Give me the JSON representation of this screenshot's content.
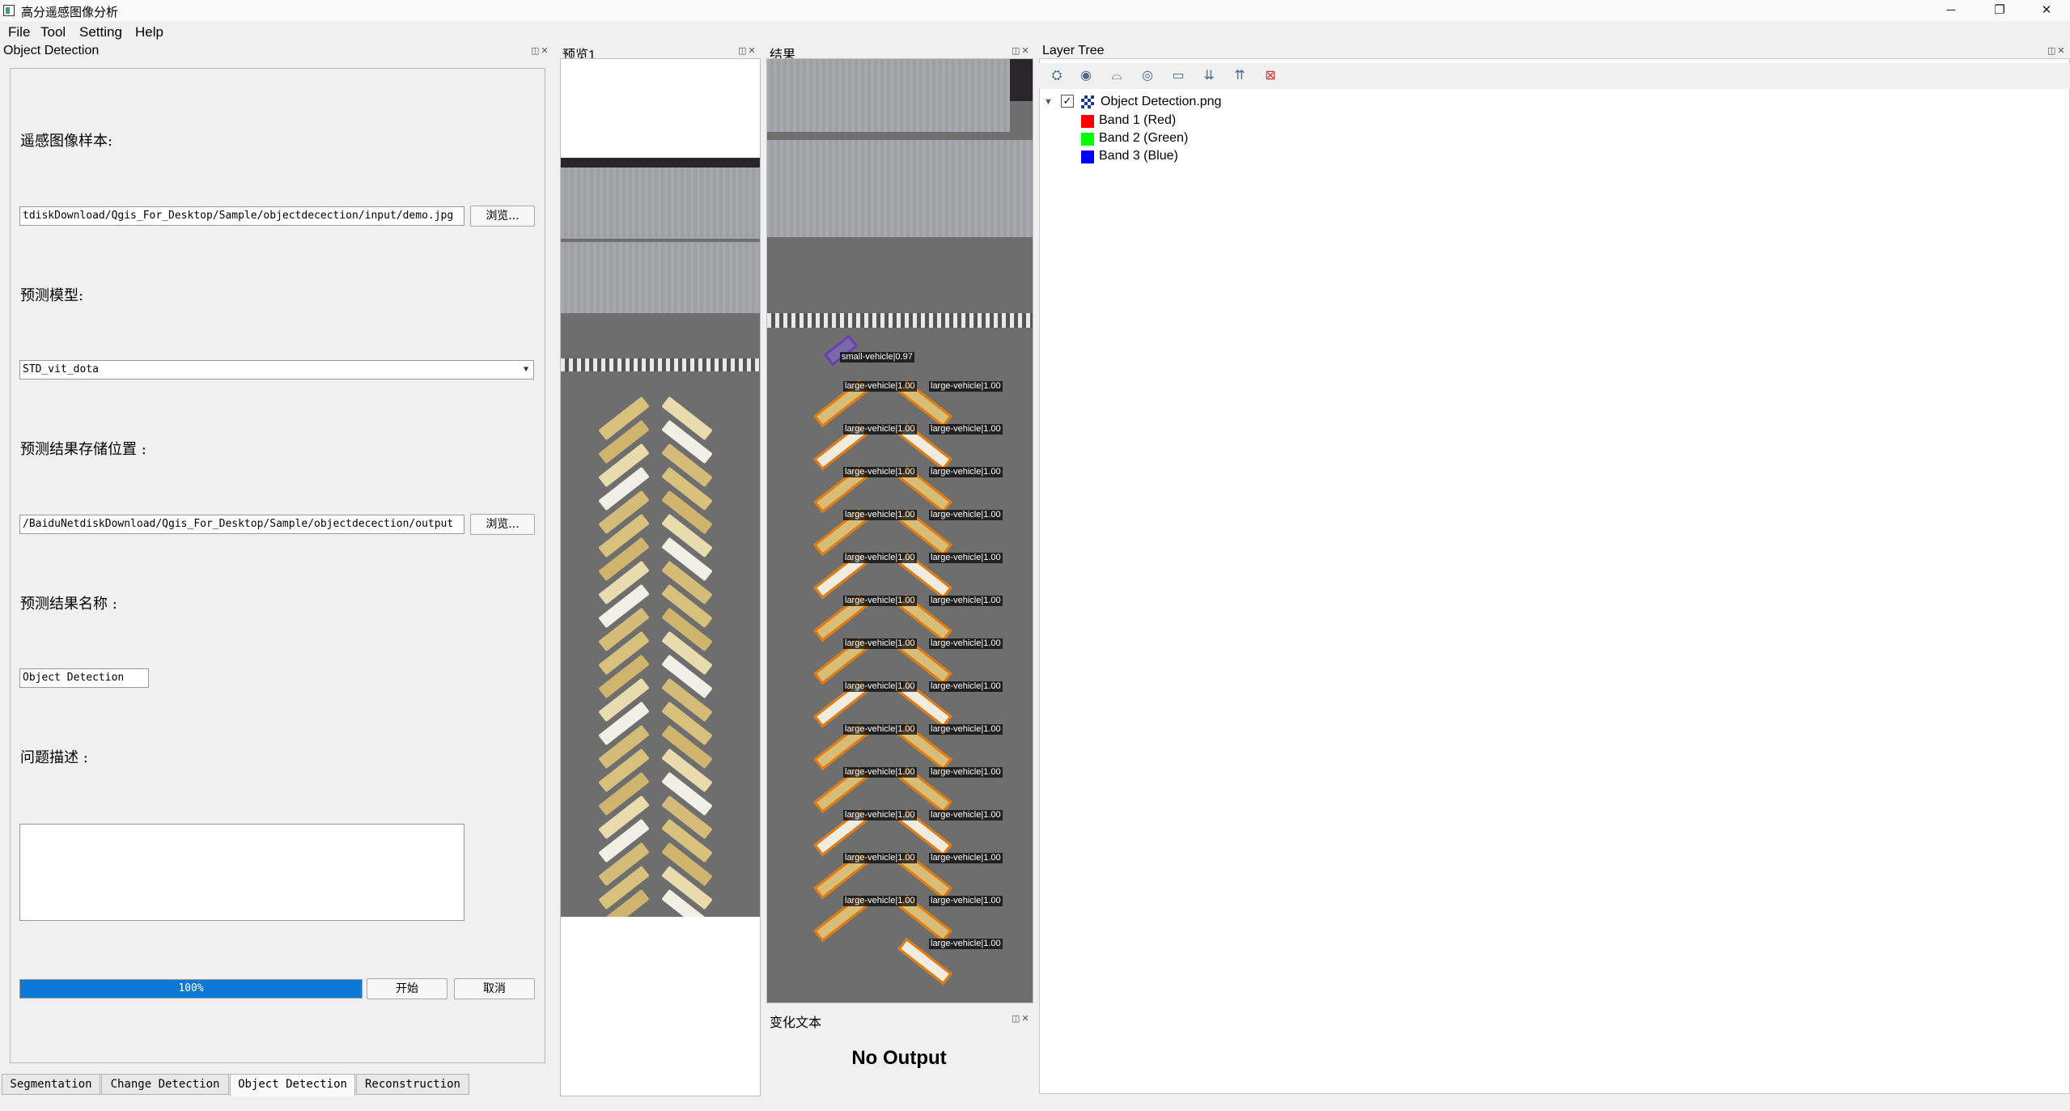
{
  "window": {
    "title": "高分遥感图像分析",
    "controls": {
      "minimize": "─",
      "restore": "❐",
      "close": "✕"
    }
  },
  "menu": [
    "File",
    "Tool",
    "Setting",
    "Help"
  ],
  "left_panel": {
    "title": "Object Detection",
    "sample_label": "遥感图像样本:",
    "sample_path": "tdiskDownload/Qgis_For_Desktop/Sample/objectdecection/input/demo.jpg",
    "browse1": "浏览...",
    "model_label": "预测模型:",
    "model_value": "STD_vit_dota",
    "output_label": "预测结果存储位置 :",
    "output_path": "/BaiduNetdiskDownload/Qgis_For_Desktop/Sample/objectdecection/output",
    "browse2": "浏览...",
    "result_name_label": "预测结果名称 :",
    "result_name_value": "Object Detection",
    "desc_label": "问题描述 :",
    "desc_value": "",
    "progress_value": 100,
    "progress_text": "100%",
    "start_button": "开始",
    "cancel_button": "取消"
  },
  "tabs": [
    "Segmentation",
    "Change Detection",
    "Object Detection",
    "Reconstruction"
  ],
  "active_tab": "Object Detection",
  "preview_panel": {
    "title": "预览1"
  },
  "result_panel": {
    "title": "结果",
    "detections": [
      "small-vehicle|0.97",
      "large-vehicle|1.00",
      "large-vehicle|1.00",
      "large-vehicle|1.00",
      "large-vehicle|1.00",
      "large-vehicle|1.00",
      "large-vehicle|1.00",
      "large-vehicle|1.00",
      "large-vehicle|1.00",
      "large-vehicle|1.00",
      "large-vehicle|1.00",
      "large-vehicle|1.00",
      "large-vehicle|1.00",
      "large-vehicle|1.00",
      "large-vehicle|1.00",
      "large-vehicle|1.00",
      "large-vehicle|1.00",
      "large-vehicle|1.00",
      "large-vehicle|1.00",
      "large-vehicle|1.00",
      "large-vehicle|1.00",
      "large-vehicle|1.00",
      "large-vehicle|1.00",
      "large-vehicle|1.00",
      "large-vehicle|1.00",
      "large-vehicle|1.00",
      "large-vehicle|1.00",
      "large-vehicle|1.00"
    ]
  },
  "change_text_panel": {
    "title": "变化文本",
    "output": "No Output"
  },
  "layer_tree": {
    "title": "Layer Tree",
    "toolbar_icons": [
      "open-layer-styling-icon",
      "visibility-icon",
      "filter-legend-icon",
      "manage-themes-icon",
      "add-group-icon",
      "expand-all-icon",
      "collapse-all-icon",
      "remove-layer-icon"
    ],
    "layer": {
      "name": "Object Detection.png",
      "checked": true
    },
    "bands": [
      {
        "label": "Band 1 (Red)",
        "color": "#ff0000"
      },
      {
        "label": "Band 2 (Green)",
        "color": "#00ff00"
      },
      {
        "label": "Band 3 (Blue)",
        "color": "#0000ff"
      }
    ]
  }
}
